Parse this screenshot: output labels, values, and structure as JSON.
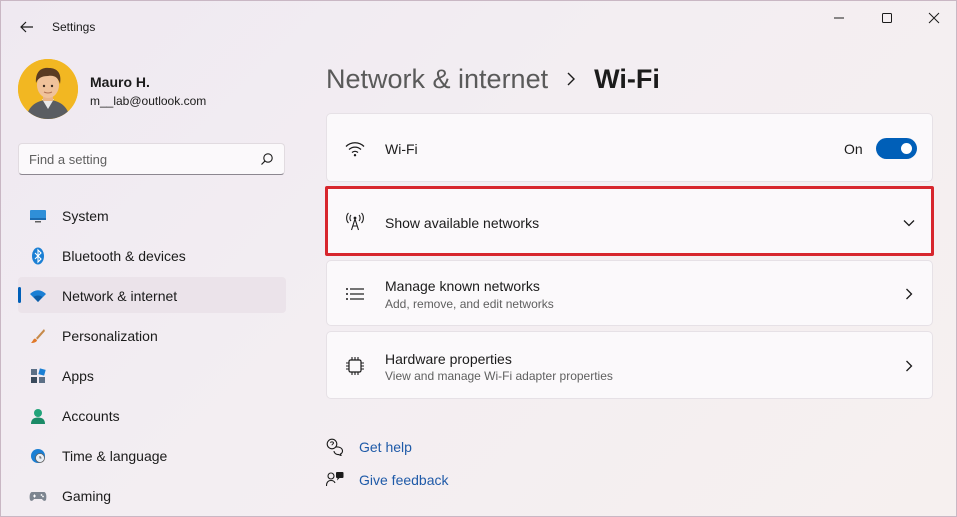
{
  "window": {
    "title": "Settings",
    "controls": {
      "minimize": "minimize-icon",
      "maximize": "maximize-icon",
      "close": "close-icon"
    }
  },
  "user": {
    "name": "Mauro H.",
    "email": "m__lab@outlook.com"
  },
  "search": {
    "placeholder": "Find a setting"
  },
  "sidebar": {
    "items": [
      {
        "label": "System",
        "icon": "system-icon",
        "selected": false
      },
      {
        "label": "Bluetooth & devices",
        "icon": "bluetooth-icon",
        "selected": false
      },
      {
        "label": "Network & internet",
        "icon": "wifi-network-icon",
        "selected": true
      },
      {
        "label": "Personalization",
        "icon": "brush-icon",
        "selected": false
      },
      {
        "label": "Apps",
        "icon": "apps-icon",
        "selected": false
      },
      {
        "label": "Accounts",
        "icon": "accounts-icon",
        "selected": false
      },
      {
        "label": "Time & language",
        "icon": "globe-clock-icon",
        "selected": false
      },
      {
        "label": "Gaming",
        "icon": "gamepad-icon",
        "selected": false
      }
    ]
  },
  "breadcrumb": {
    "parent": "Network & internet",
    "current": "Wi-Fi"
  },
  "cards": {
    "wifi": {
      "title": "Wi-Fi",
      "toggle_label": "On",
      "toggle_on": true
    },
    "show_networks": {
      "title": "Show available networks"
    },
    "known_networks": {
      "title": "Manage known networks",
      "subtitle": "Add, remove, and edit networks"
    },
    "hardware": {
      "title": "Hardware properties",
      "subtitle": "View and manage Wi-Fi adapter properties"
    }
  },
  "links": {
    "help": "Get help",
    "feedback": "Give feedback"
  },
  "colors": {
    "accent": "#005fb8",
    "highlight_border": "#d7262d",
    "link": "#1f5aa8"
  }
}
